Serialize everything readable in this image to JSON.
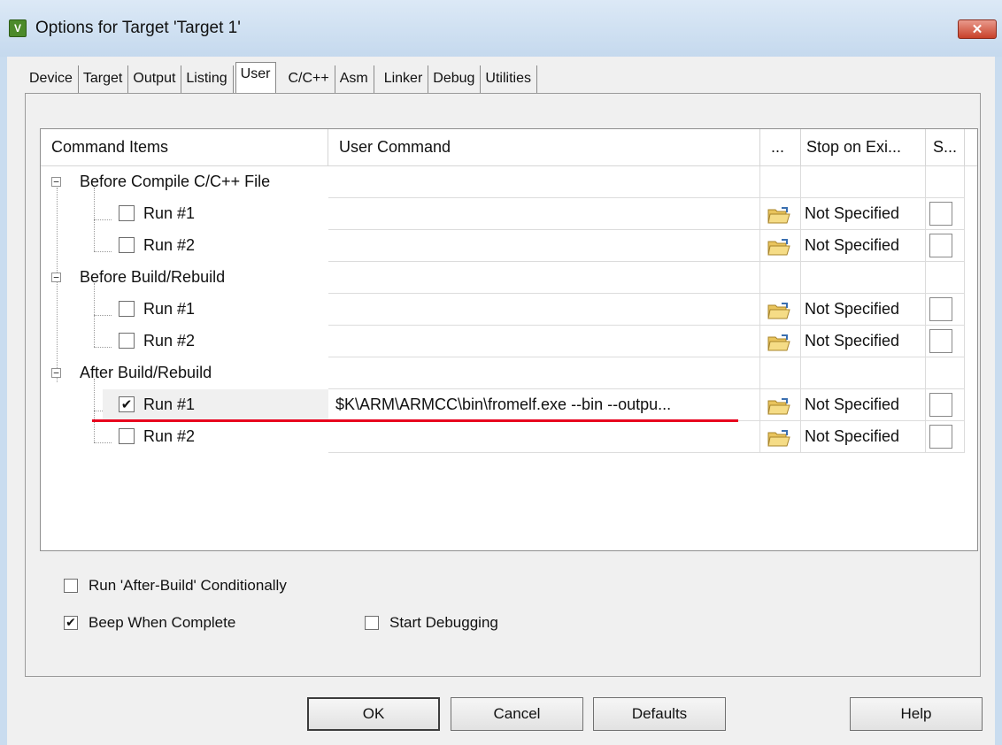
{
  "window": {
    "title": "Options for Target 'Target 1'",
    "icon_letter": "V",
    "close_glyph": "✕"
  },
  "tabs": [
    {
      "label": "Device",
      "active": false
    },
    {
      "label": "Target",
      "active": false
    },
    {
      "label": "Output",
      "active": false
    },
    {
      "label": "Listing",
      "active": false
    },
    {
      "label": "User",
      "active": true
    },
    {
      "label": "C/C++",
      "active": false
    },
    {
      "label": "Asm",
      "active": false
    },
    {
      "label": "Linker",
      "active": false
    },
    {
      "label": "Debug",
      "active": false
    },
    {
      "label": "Utilities",
      "active": false
    }
  ],
  "grid": {
    "headers": {
      "items": "Command Items",
      "command": "User Command",
      "browse": "...",
      "stop": "Stop on Exi...",
      "s": "S..."
    },
    "groups": [
      {
        "label": "Before Compile C/C++ File",
        "expander": "−",
        "runs": [
          {
            "label": "Run #1",
            "checked": false,
            "command": "",
            "stop": "Not Specified"
          },
          {
            "label": "Run #2",
            "checked": false,
            "command": "",
            "stop": "Not Specified"
          }
        ]
      },
      {
        "label": "Before Build/Rebuild",
        "expander": "−",
        "runs": [
          {
            "label": "Run #1",
            "checked": false,
            "command": "",
            "stop": "Not Specified"
          },
          {
            "label": "Run #2",
            "checked": false,
            "command": "",
            "stop": "Not Specified"
          }
        ]
      },
      {
        "label": "After Build/Rebuild",
        "expander": "−",
        "runs": [
          {
            "label": "Run #1",
            "checked": true,
            "command": "$K\\ARM\\ARMCC\\bin\\fromelf.exe --bin --outpu...",
            "stop": "Not Specified"
          },
          {
            "label": "Run #2",
            "checked": false,
            "command": "",
            "stop": "Not Specified"
          }
        ]
      }
    ]
  },
  "options": {
    "run_after_build_conditionally": {
      "label": "Run 'After-Build' Conditionally",
      "checked": false
    },
    "beep_when_complete": {
      "label": "Beep When Complete",
      "checked": true
    },
    "start_debugging": {
      "label": "Start Debugging",
      "checked": false
    }
  },
  "buttons": {
    "ok": "OK",
    "cancel": "Cancel",
    "defaults": "Defaults",
    "help": "Help"
  },
  "check_glyph": "✔",
  "colors": {
    "annotation_line": "#e8001e",
    "titlebar": "#c9dcef"
  }
}
